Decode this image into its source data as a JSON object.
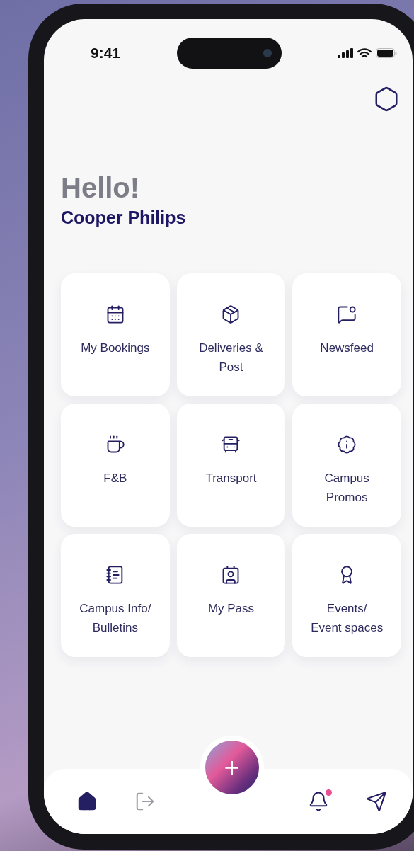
{
  "status_bar": {
    "time": "9:41"
  },
  "greeting": {
    "title": "Hello!",
    "name": "Cooper Philips"
  },
  "tiles": [
    {
      "label": [
        "My Bookings"
      ]
    },
    {
      "label": [
        "Deliveries &",
        "Post"
      ]
    },
    {
      "label": [
        "Newsfeed"
      ]
    },
    {
      "label": [
        "F&B"
      ]
    },
    {
      "label": [
        "Transport"
      ]
    },
    {
      "label": [
        "Campus",
        "Promos"
      ]
    },
    {
      "label": [
        "Campus Info/",
        "Bulletins"
      ]
    },
    {
      "label": [
        "My Pass"
      ]
    },
    {
      "label": [
        "Events/",
        "Event spaces"
      ]
    }
  ],
  "fab": {
    "label": "+"
  },
  "nav": [
    {
      "selected": true
    },
    {
      "selected": false
    },
    {
      "selected": false,
      "badge": true
    },
    {
      "selected": false
    }
  ]
}
